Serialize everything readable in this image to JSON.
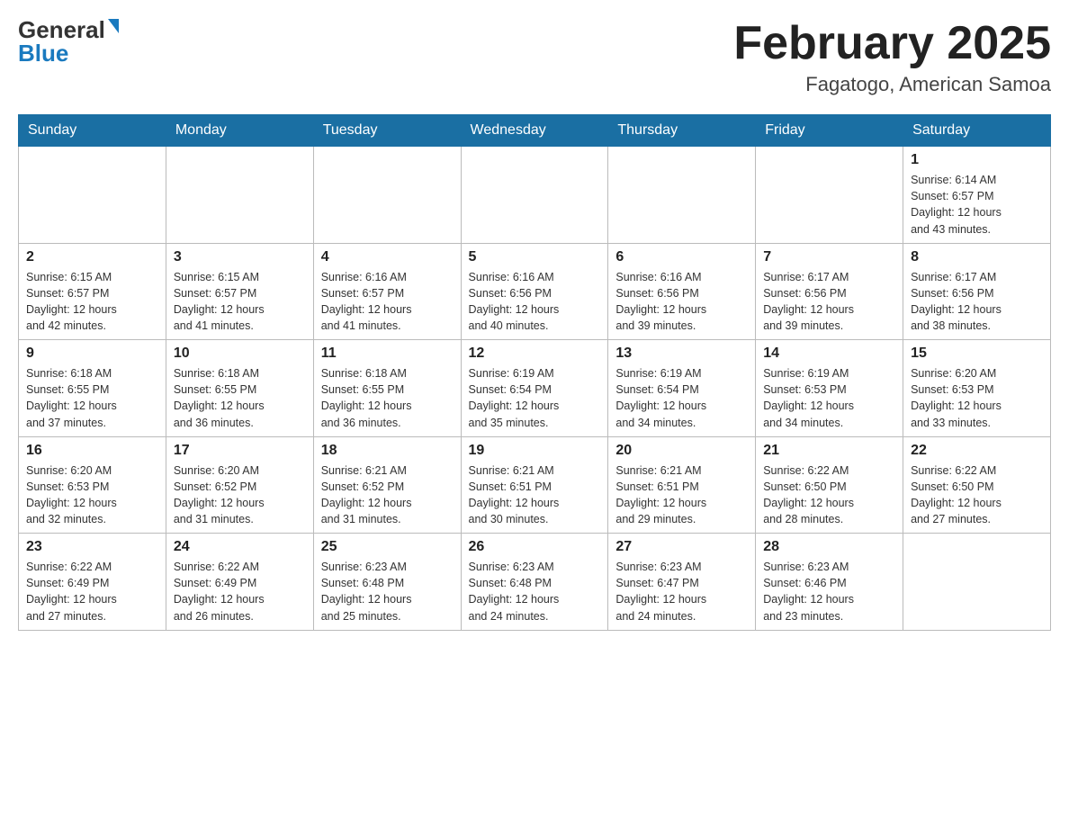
{
  "header": {
    "logo_general": "General",
    "logo_blue": "Blue",
    "month_title": "February 2025",
    "location": "Fagatogo, American Samoa"
  },
  "days_of_week": [
    "Sunday",
    "Monday",
    "Tuesday",
    "Wednesday",
    "Thursday",
    "Friday",
    "Saturday"
  ],
  "weeks": [
    [
      {
        "day": "",
        "info": ""
      },
      {
        "day": "",
        "info": ""
      },
      {
        "day": "",
        "info": ""
      },
      {
        "day": "",
        "info": ""
      },
      {
        "day": "",
        "info": ""
      },
      {
        "day": "",
        "info": ""
      },
      {
        "day": "1",
        "info": "Sunrise: 6:14 AM\nSunset: 6:57 PM\nDaylight: 12 hours\nand 43 minutes."
      }
    ],
    [
      {
        "day": "2",
        "info": "Sunrise: 6:15 AM\nSunset: 6:57 PM\nDaylight: 12 hours\nand 42 minutes."
      },
      {
        "day": "3",
        "info": "Sunrise: 6:15 AM\nSunset: 6:57 PM\nDaylight: 12 hours\nand 41 minutes."
      },
      {
        "day": "4",
        "info": "Sunrise: 6:16 AM\nSunset: 6:57 PM\nDaylight: 12 hours\nand 41 minutes."
      },
      {
        "day": "5",
        "info": "Sunrise: 6:16 AM\nSunset: 6:56 PM\nDaylight: 12 hours\nand 40 minutes."
      },
      {
        "day": "6",
        "info": "Sunrise: 6:16 AM\nSunset: 6:56 PM\nDaylight: 12 hours\nand 39 minutes."
      },
      {
        "day": "7",
        "info": "Sunrise: 6:17 AM\nSunset: 6:56 PM\nDaylight: 12 hours\nand 39 minutes."
      },
      {
        "day": "8",
        "info": "Sunrise: 6:17 AM\nSunset: 6:56 PM\nDaylight: 12 hours\nand 38 minutes."
      }
    ],
    [
      {
        "day": "9",
        "info": "Sunrise: 6:18 AM\nSunset: 6:55 PM\nDaylight: 12 hours\nand 37 minutes."
      },
      {
        "day": "10",
        "info": "Sunrise: 6:18 AM\nSunset: 6:55 PM\nDaylight: 12 hours\nand 36 minutes."
      },
      {
        "day": "11",
        "info": "Sunrise: 6:18 AM\nSunset: 6:55 PM\nDaylight: 12 hours\nand 36 minutes."
      },
      {
        "day": "12",
        "info": "Sunrise: 6:19 AM\nSunset: 6:54 PM\nDaylight: 12 hours\nand 35 minutes."
      },
      {
        "day": "13",
        "info": "Sunrise: 6:19 AM\nSunset: 6:54 PM\nDaylight: 12 hours\nand 34 minutes."
      },
      {
        "day": "14",
        "info": "Sunrise: 6:19 AM\nSunset: 6:53 PM\nDaylight: 12 hours\nand 34 minutes."
      },
      {
        "day": "15",
        "info": "Sunrise: 6:20 AM\nSunset: 6:53 PM\nDaylight: 12 hours\nand 33 minutes."
      }
    ],
    [
      {
        "day": "16",
        "info": "Sunrise: 6:20 AM\nSunset: 6:53 PM\nDaylight: 12 hours\nand 32 minutes."
      },
      {
        "day": "17",
        "info": "Sunrise: 6:20 AM\nSunset: 6:52 PM\nDaylight: 12 hours\nand 31 minutes."
      },
      {
        "day": "18",
        "info": "Sunrise: 6:21 AM\nSunset: 6:52 PM\nDaylight: 12 hours\nand 31 minutes."
      },
      {
        "day": "19",
        "info": "Sunrise: 6:21 AM\nSunset: 6:51 PM\nDaylight: 12 hours\nand 30 minutes."
      },
      {
        "day": "20",
        "info": "Sunrise: 6:21 AM\nSunset: 6:51 PM\nDaylight: 12 hours\nand 29 minutes."
      },
      {
        "day": "21",
        "info": "Sunrise: 6:22 AM\nSunset: 6:50 PM\nDaylight: 12 hours\nand 28 minutes."
      },
      {
        "day": "22",
        "info": "Sunrise: 6:22 AM\nSunset: 6:50 PM\nDaylight: 12 hours\nand 27 minutes."
      }
    ],
    [
      {
        "day": "23",
        "info": "Sunrise: 6:22 AM\nSunset: 6:49 PM\nDaylight: 12 hours\nand 27 minutes."
      },
      {
        "day": "24",
        "info": "Sunrise: 6:22 AM\nSunset: 6:49 PM\nDaylight: 12 hours\nand 26 minutes."
      },
      {
        "day": "25",
        "info": "Sunrise: 6:23 AM\nSunset: 6:48 PM\nDaylight: 12 hours\nand 25 minutes."
      },
      {
        "day": "26",
        "info": "Sunrise: 6:23 AM\nSunset: 6:48 PM\nDaylight: 12 hours\nand 24 minutes."
      },
      {
        "day": "27",
        "info": "Sunrise: 6:23 AM\nSunset: 6:47 PM\nDaylight: 12 hours\nand 24 minutes."
      },
      {
        "day": "28",
        "info": "Sunrise: 6:23 AM\nSunset: 6:46 PM\nDaylight: 12 hours\nand 23 minutes."
      },
      {
        "day": "",
        "info": ""
      }
    ]
  ]
}
